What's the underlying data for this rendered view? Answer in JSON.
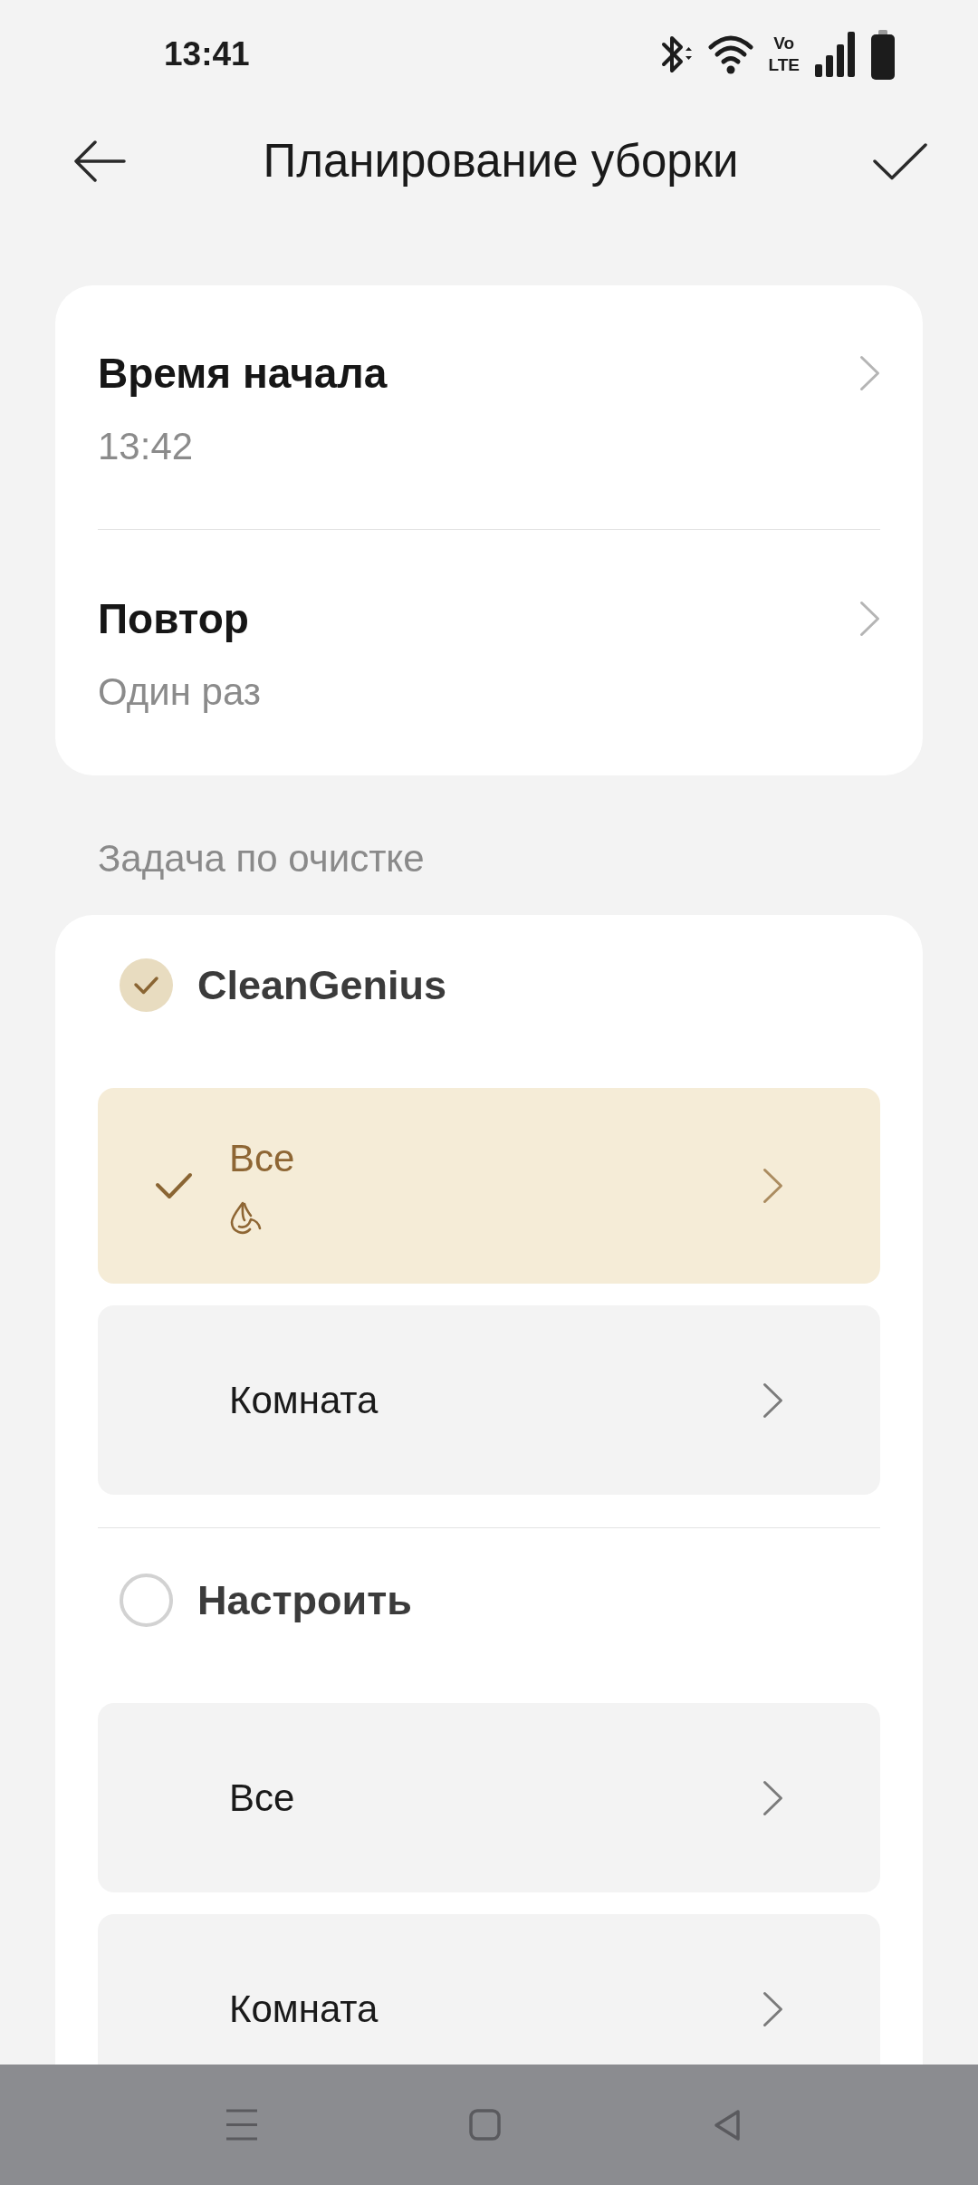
{
  "status_bar": {
    "time": "13:41",
    "volte": [
      "Vo",
      "LTE"
    ]
  },
  "header": {
    "title": "Планирование уборки"
  },
  "schedule": [
    {
      "label": "Время начала",
      "value": "13:42"
    },
    {
      "label": "Повтор",
      "value": "Один раз"
    }
  ],
  "task": {
    "heading": "Задача по очистке",
    "groups": [
      {
        "name": "CleanGenius",
        "selected": true,
        "options": [
          {
            "label": "Все",
            "selected": true,
            "mode_icon": true
          },
          {
            "label": "Комната",
            "selected": false,
            "mode_icon": false
          }
        ]
      },
      {
        "name": "Настроить",
        "selected": false,
        "options": [
          {
            "label": "Все",
            "selected": false,
            "mode_icon": false
          },
          {
            "label": "Комната",
            "selected": false,
            "mode_icon": false
          }
        ]
      }
    ]
  }
}
